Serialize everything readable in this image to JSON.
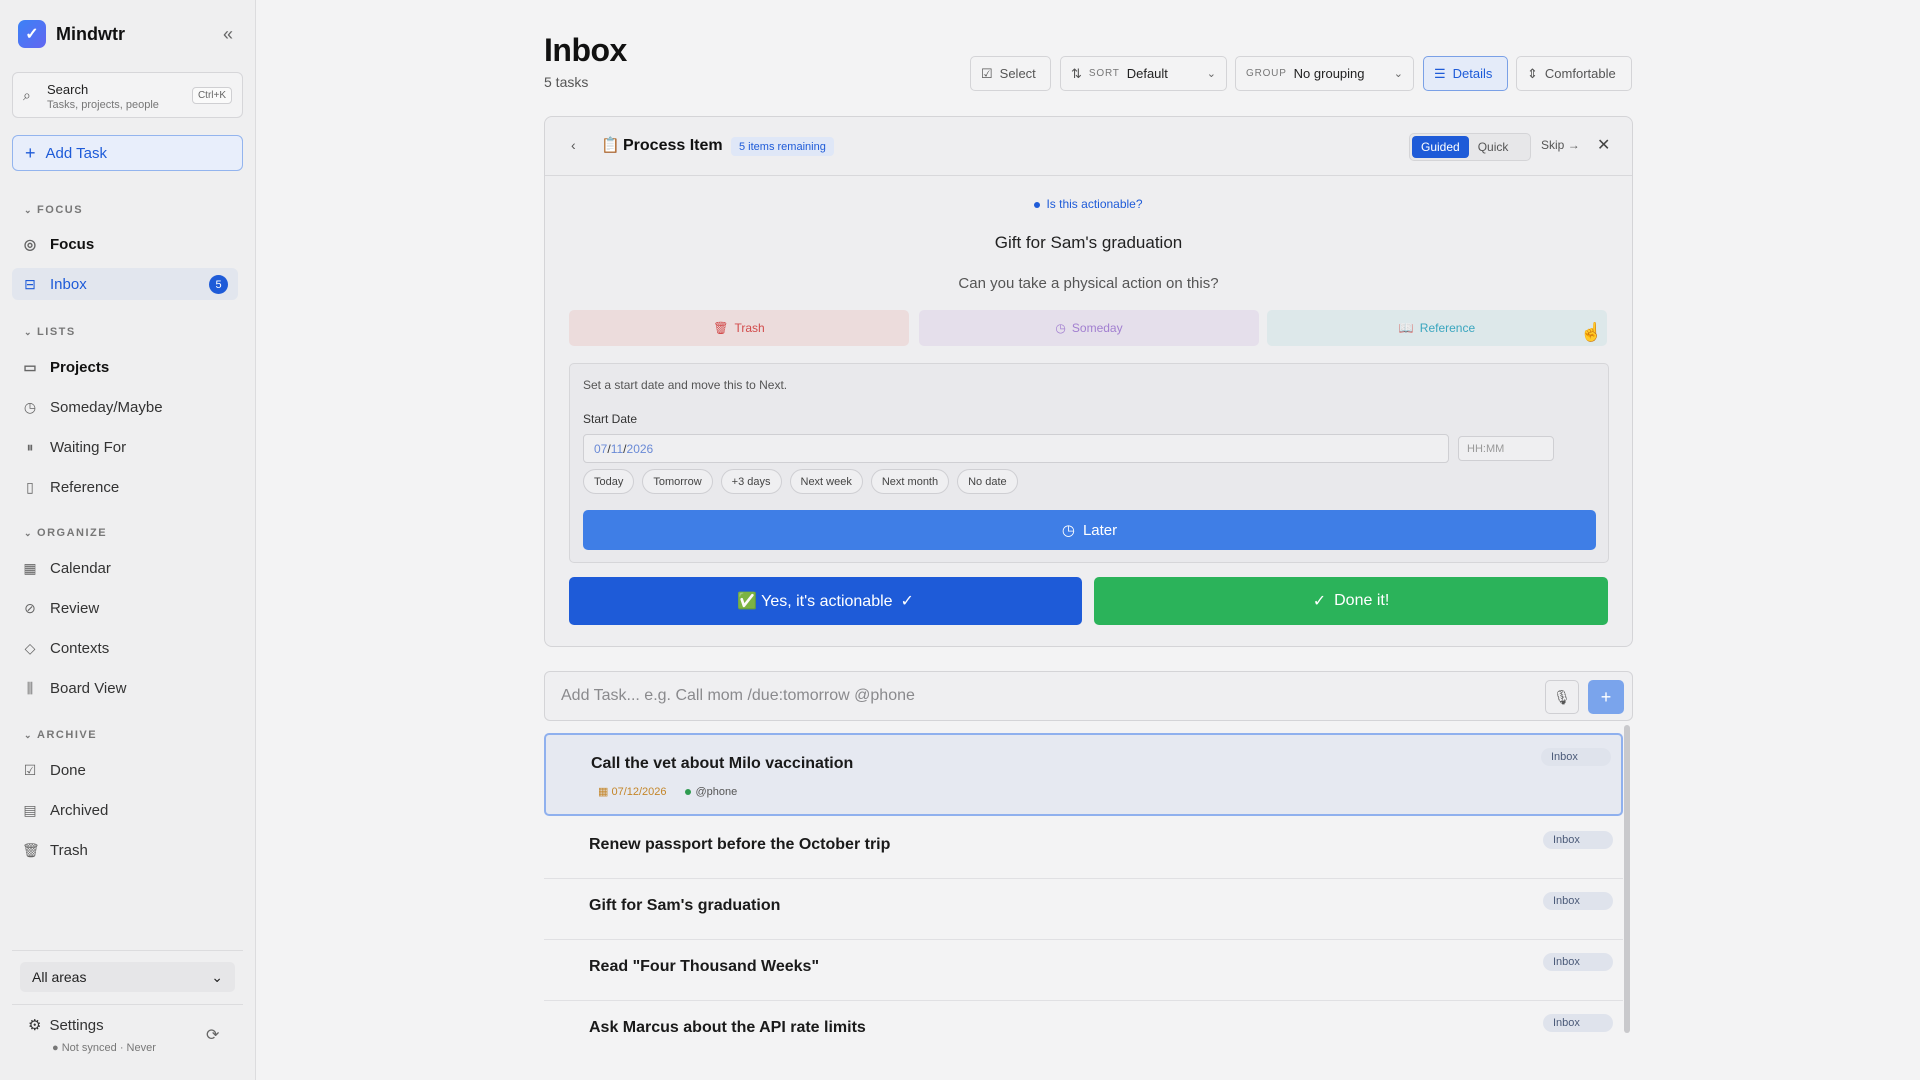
{
  "sidebar": {
    "app_name": "Mindwtr",
    "collapse_icon": "double-chevron-left-icon",
    "search": {
      "title": "Search",
      "subtitle": "Tasks, projects, people",
      "shortcut": "Ctrl+K"
    },
    "add_task_label": "Add Task",
    "sections": {
      "focus": "FOCUS",
      "lists": "LISTS",
      "organize": "ORGANIZE",
      "archive": "ARCHIVE"
    },
    "items": {
      "focus": "Focus",
      "inbox": "Inbox",
      "inbox_count": "5",
      "projects": "Projects",
      "someday": "Someday/Maybe",
      "waiting": "Waiting For",
      "reference": "Reference",
      "calendar": "Calendar",
      "review": "Review",
      "contexts": "Contexts",
      "board": "Board View",
      "done": "Done",
      "archived": "Archived",
      "trash": "Trash"
    },
    "areas_value": "All areas",
    "settings_label": "Settings",
    "sync_status": "Not synced",
    "sync_time": "Never"
  },
  "header": {
    "title": "Inbox",
    "subtitle": "5 tasks",
    "select_label": "Select",
    "sort_label": "SORT",
    "sort_value": "Default",
    "group_label": "GROUP",
    "group_value": "No grouping",
    "details_label": "Details",
    "density_label": "Comfortable"
  },
  "process": {
    "title": "Process Item",
    "remaining": "5 items remaining",
    "mode_guided": "Guided",
    "mode_quick": "Quick",
    "skip_label": "Skip",
    "step_label": "Is this actionable?",
    "item_title": "Gift for Sam's graduation",
    "question": "Can you take a physical action on this?",
    "opt_trash": "Trash",
    "opt_someday": "Someday",
    "opt_reference": "Reference",
    "later_desc": "Set a start date and move this to Next.",
    "start_date_label": "Start Date",
    "date_month": "07",
    "date_day": "11",
    "date_year": "2026",
    "time_placeholder": "HH:MM",
    "quick_dates": [
      "Today",
      "Tomorrow",
      "+3 days",
      "Next week",
      "Next month",
      "No date"
    ],
    "later_label": "Later",
    "yes_label": "✅ Yes, it's actionable",
    "done_label": "Done it!"
  },
  "quick_add": {
    "placeholder": "Add Task... e.g. Call mom /due:tomorrow @phone"
  },
  "tasks": [
    {
      "title": "Call the vet about Milo vaccination",
      "due": "07/12/2026",
      "context": "@phone",
      "tag": "Inbox"
    },
    {
      "title": "Renew passport before the October trip",
      "tag": "Inbox"
    },
    {
      "title": "Gift for Sam's graduation",
      "tag": "Inbox"
    },
    {
      "title": "Read \"Four Thousand Weeks\"",
      "tag": "Inbox"
    },
    {
      "title": "Ask Marcus about the API rate limits",
      "tag": "Inbox"
    }
  ],
  "colors": {
    "accent": "#1e5bd8",
    "success": "#2bb35a",
    "danger": "#d24b4b"
  }
}
